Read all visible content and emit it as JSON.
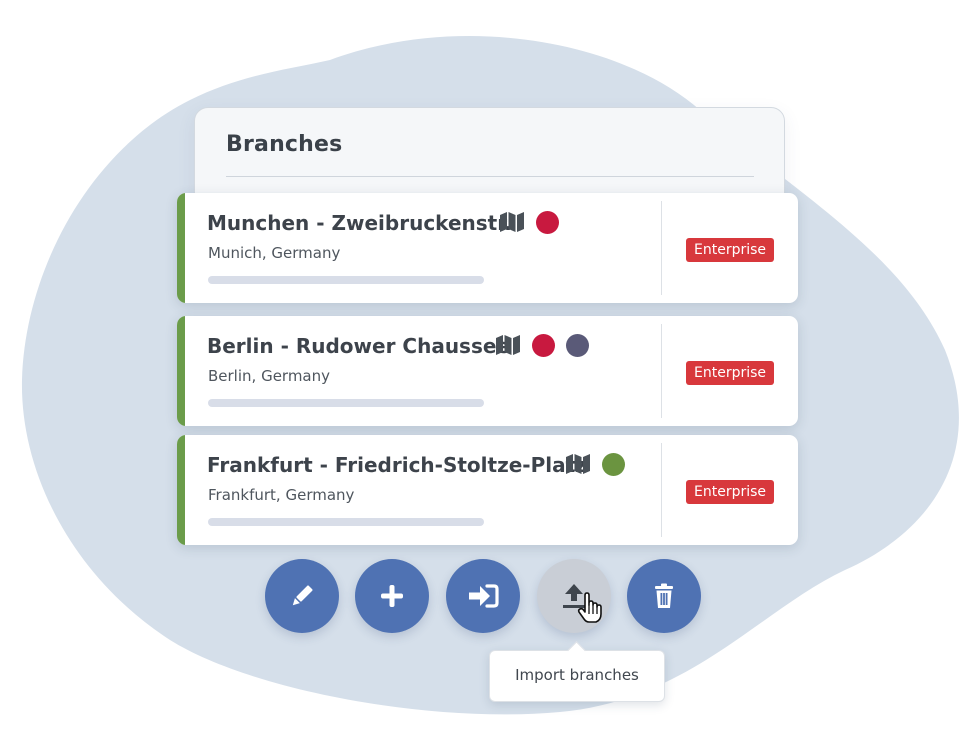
{
  "panel": {
    "title": "Branches"
  },
  "colors": {
    "accent_green": "#6b9c4a",
    "enterprise_red": "#d8383c",
    "fab_blue": "#4f72b3"
  },
  "branches": [
    {
      "name": "Munchen - Zweibruckenstr.",
      "location": "Munich, Germany",
      "plan": "Enterprise",
      "status_dots": [
        "#c8193f"
      ]
    },
    {
      "name": "Berlin - Rudower Chaussee",
      "location": "Berlin, Germany",
      "plan": "Enterprise",
      "status_dots": [
        "#c8193f",
        "#5a5a78"
      ]
    },
    {
      "name": "Frankfurt - Friedrich-Stoltze-Platz",
      "location": "Frankfurt, Germany",
      "plan": "Enterprise",
      "status_dots": [
        "#6b9440"
      ]
    }
  ],
  "actions": [
    {
      "name": "edit",
      "icon": "pencil-icon"
    },
    {
      "name": "add",
      "icon": "plus-icon"
    },
    {
      "name": "login",
      "icon": "sign-in-icon"
    },
    {
      "name": "import",
      "icon": "upload-icon",
      "state": "hovered"
    },
    {
      "name": "delete",
      "icon": "trash-icon"
    }
  ],
  "tooltip": {
    "label": "Import branches"
  }
}
